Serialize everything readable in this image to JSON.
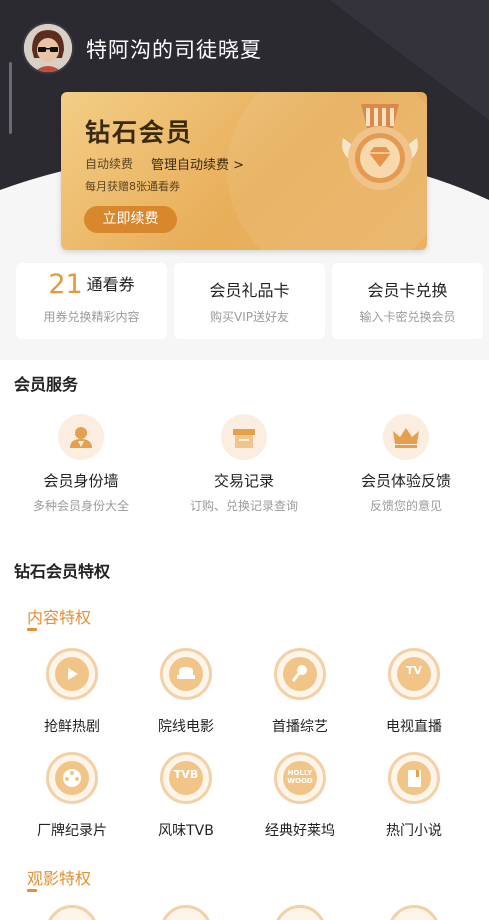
{
  "user": {
    "name": "特阿沟的司徒晓夏"
  },
  "vip_card": {
    "title": "钻石会员",
    "auto_renew": "自动续费",
    "manage_link": "管理自动续费 >",
    "monthly_note": "每月获赠8张通看券",
    "renew_button": "立即续费"
  },
  "quick_cards": [
    {
      "count": "21",
      "title": "通看券",
      "sub": "用券兑换精彩内容"
    },
    {
      "title": "会员礼品卡",
      "sub": "购买VIP送好友"
    },
    {
      "title": "会员卡兑换",
      "sub": "输入卡密兑换会员"
    }
  ],
  "services": {
    "title": "会员服务",
    "items": [
      {
        "label": "会员身份墙",
        "desc": "多种会员身份大全",
        "icon": "member-badge-icon"
      },
      {
        "label": "交易记录",
        "desc": "订购、兑换记录查询",
        "icon": "transaction-box-icon"
      },
      {
        "label": "会员体验反馈",
        "desc": "反馈您的意见",
        "icon": "crown-icon"
      }
    ]
  },
  "privileges": {
    "title": "钻石会员特权",
    "content_title": "内容特权",
    "content_items": [
      {
        "label": "抢鲜热剧",
        "icon": "unlock-play-icon"
      },
      {
        "label": "院线电影",
        "icon": "cinema-seat-icon"
      },
      {
        "label": "首播综艺",
        "icon": "microphone-icon"
      },
      {
        "label": "电视直播",
        "icon": "tv-icon",
        "text": "TV"
      },
      {
        "label": "厂牌纪录片",
        "icon": "film-reel-icon"
      },
      {
        "label": "风味TVB",
        "icon": "tvb-icon",
        "text": "TVB"
      },
      {
        "label": "经典好莱坞",
        "icon": "hollywood-icon",
        "text": "HOLLY WOOD"
      },
      {
        "label": "热门小说",
        "icon": "book-icon"
      }
    ],
    "viewing_title": "观影特权"
  },
  "colors": {
    "accent": "#e39036",
    "dark_bg": "#2b2a31",
    "card_gold": "#eab367"
  }
}
